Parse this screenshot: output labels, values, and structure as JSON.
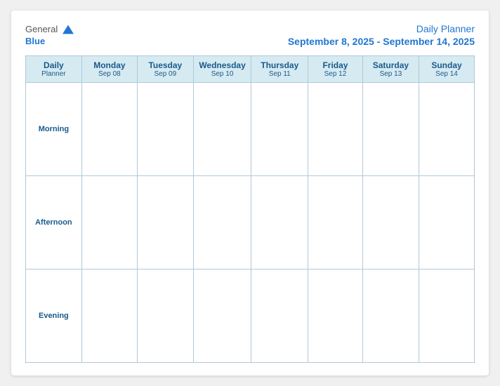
{
  "header": {
    "logo_general": "General",
    "logo_blue": "Blue",
    "title": "Daily Planner",
    "date_range": "September 8, 2025 - September 14, 2025"
  },
  "table": {
    "header_col0_line1": "Daily",
    "header_col0_line2": "Planner",
    "columns": [
      {
        "day": "Monday",
        "date": "Sep 08"
      },
      {
        "day": "Tuesday",
        "date": "Sep 09"
      },
      {
        "day": "Wednesday",
        "date": "Sep 10"
      },
      {
        "day": "Thursday",
        "date": "Sep 11"
      },
      {
        "day": "Friday",
        "date": "Sep 12"
      },
      {
        "day": "Saturday",
        "date": "Sep 13"
      },
      {
        "day": "Sunday",
        "date": "Sep 14"
      }
    ],
    "rows": [
      {
        "label": "Morning"
      },
      {
        "label": "Afternoon"
      },
      {
        "label": "Evening"
      }
    ]
  }
}
